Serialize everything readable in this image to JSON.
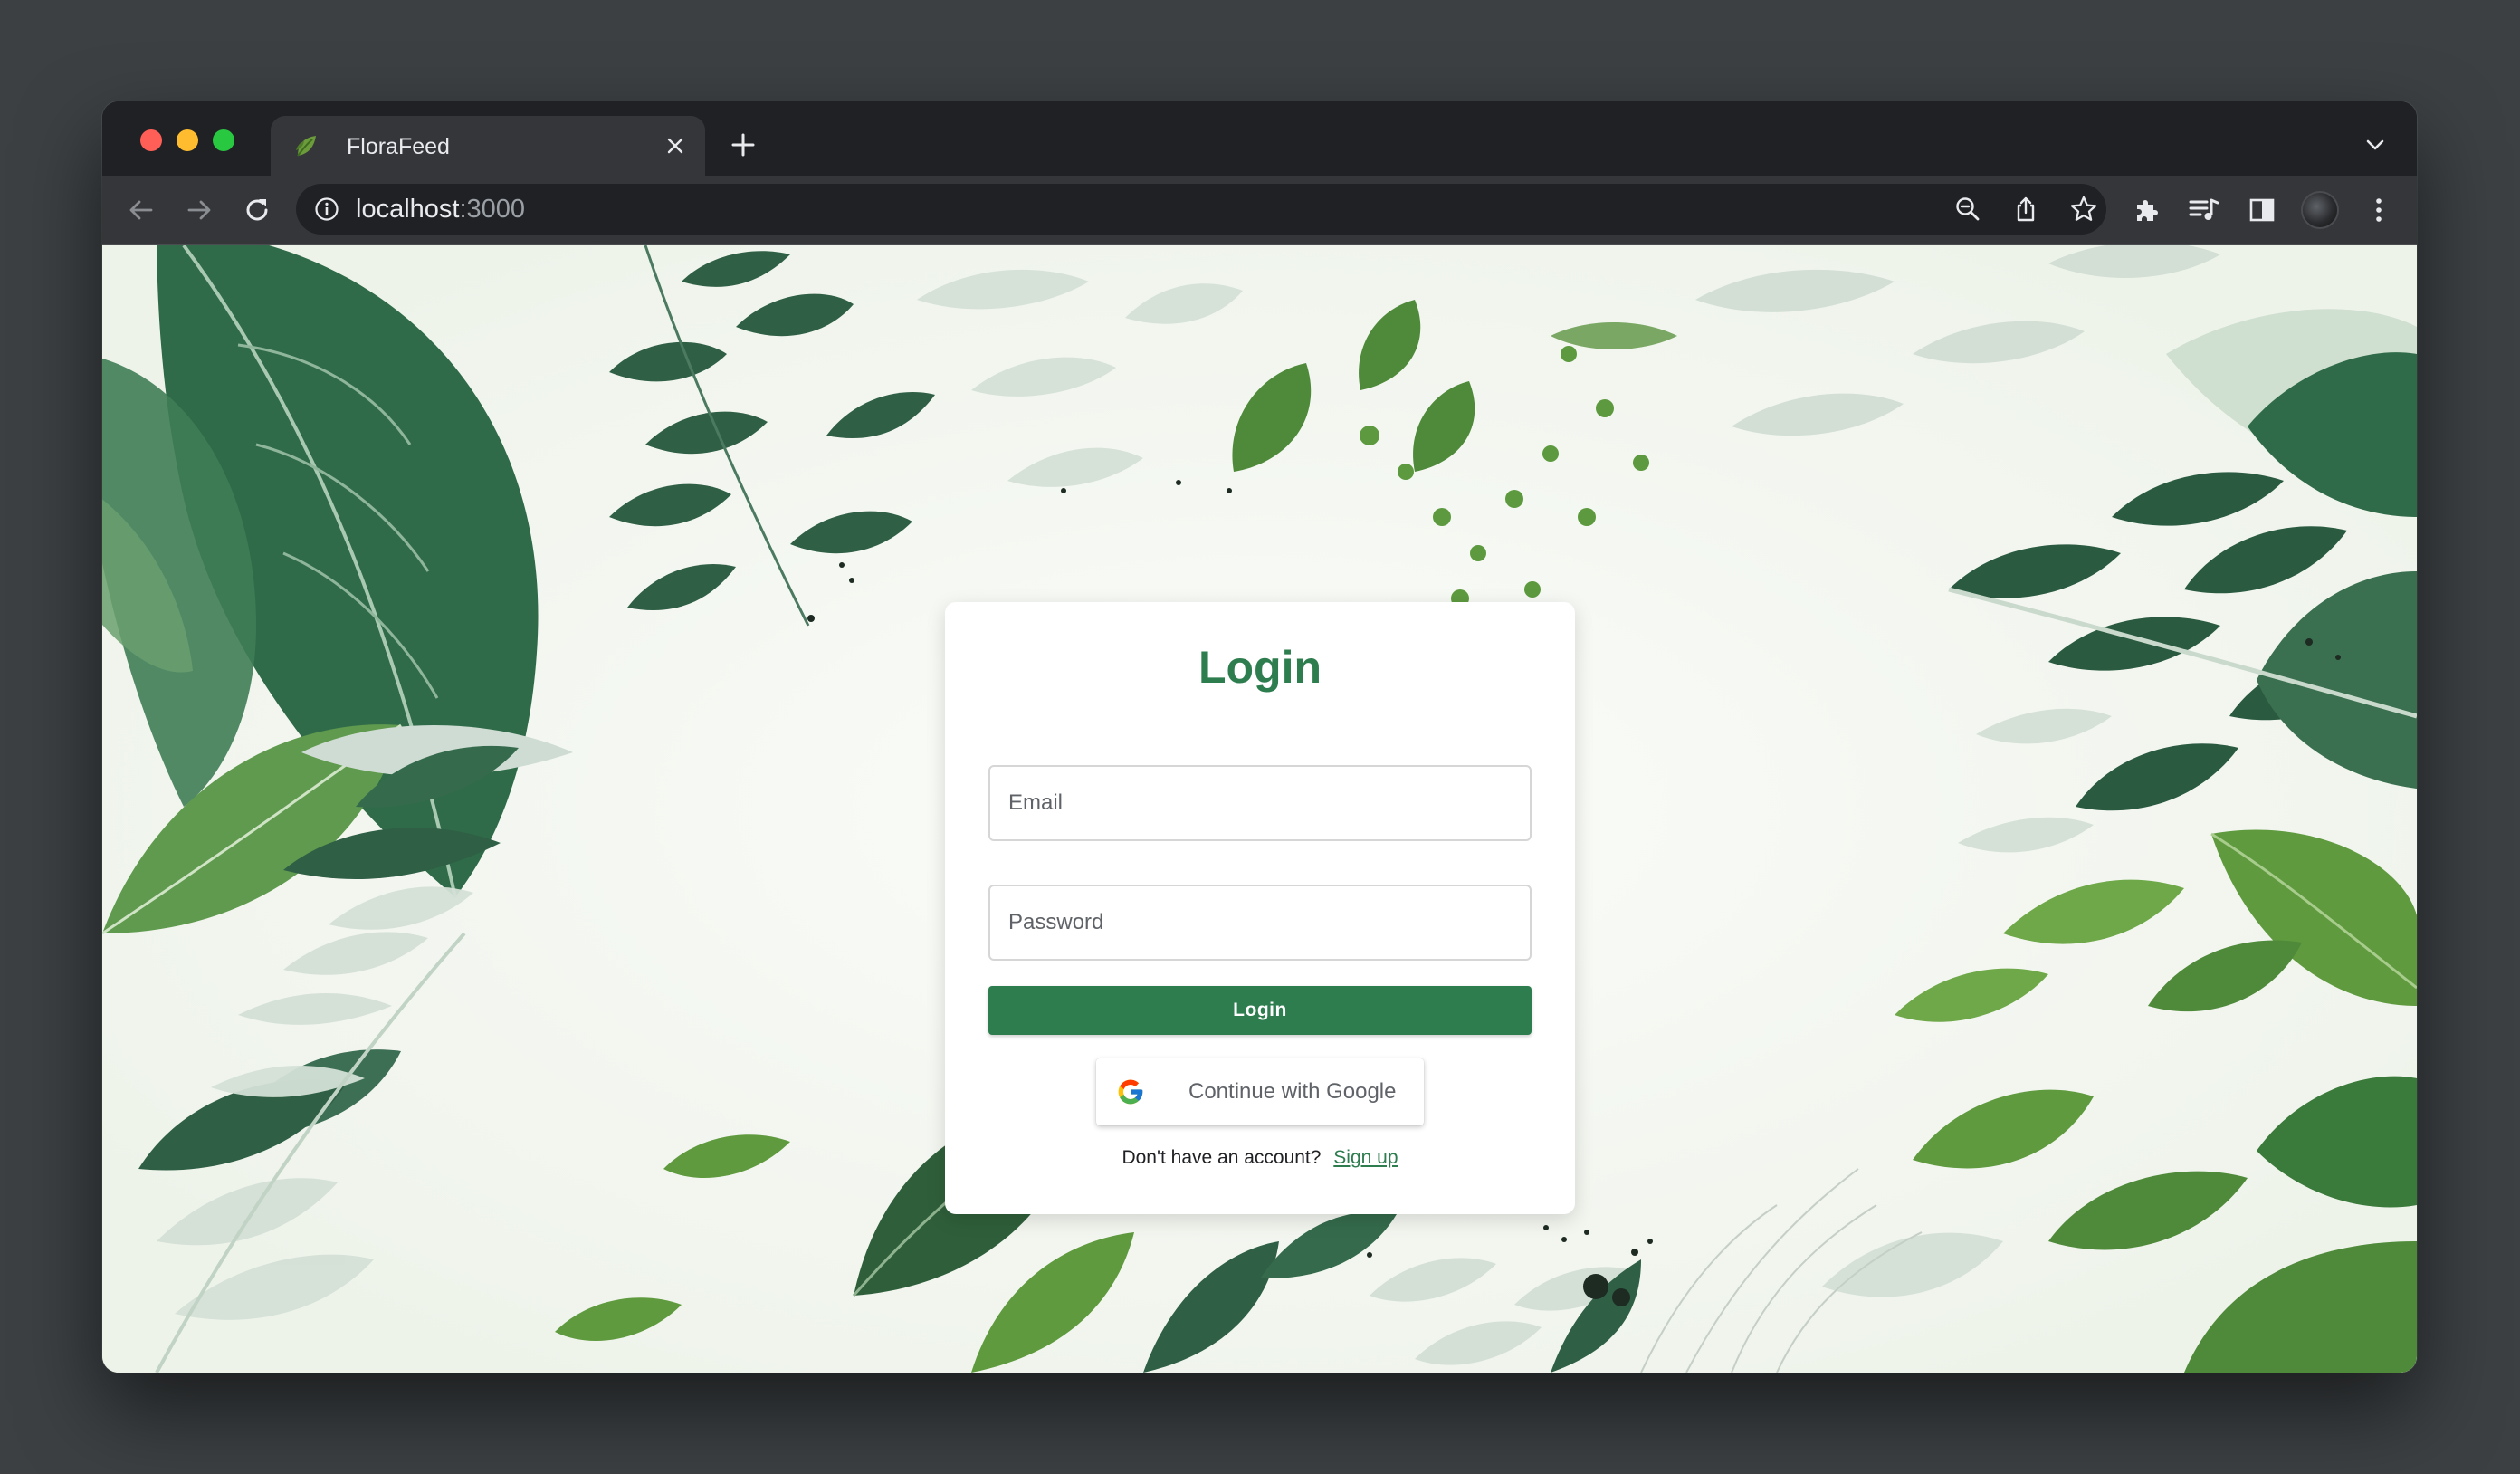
{
  "browser": {
    "tab": {
      "title": "FloraFeed",
      "favicon": "leaf-icon"
    },
    "address_bar": {
      "host": "localhost",
      "port": ":3000"
    },
    "icons": {
      "back": "arrow-left-icon",
      "forward": "arrow-right-icon",
      "reload": "reload-icon",
      "site_info": "info-icon",
      "zoom": "zoom-out-icon",
      "share": "share-icon",
      "bookmark": "star-icon",
      "extensions": "puzzle-icon",
      "media": "media-control-icon",
      "side_panel": "side-panel-icon",
      "menu": "kebab-menu-icon",
      "new_tab": "plus-icon",
      "tab_close": "close-icon",
      "tab_search": "chevron-down-icon"
    },
    "colors": {
      "frame": "#202124",
      "toolbar": "#35363a",
      "close": "#ff5f57",
      "minimize": "#febc2e",
      "maximize": "#28c840"
    }
  },
  "login": {
    "title": "Login",
    "email_placeholder": "Email",
    "password_placeholder": "Password",
    "submit_label": "Login",
    "google_label": "Continue with Google",
    "signup_prompt": "Don't have an account?",
    "signup_link": "Sign up"
  },
  "theme": {
    "accent": "#2e7d4f",
    "background": "botanical green leaves"
  }
}
